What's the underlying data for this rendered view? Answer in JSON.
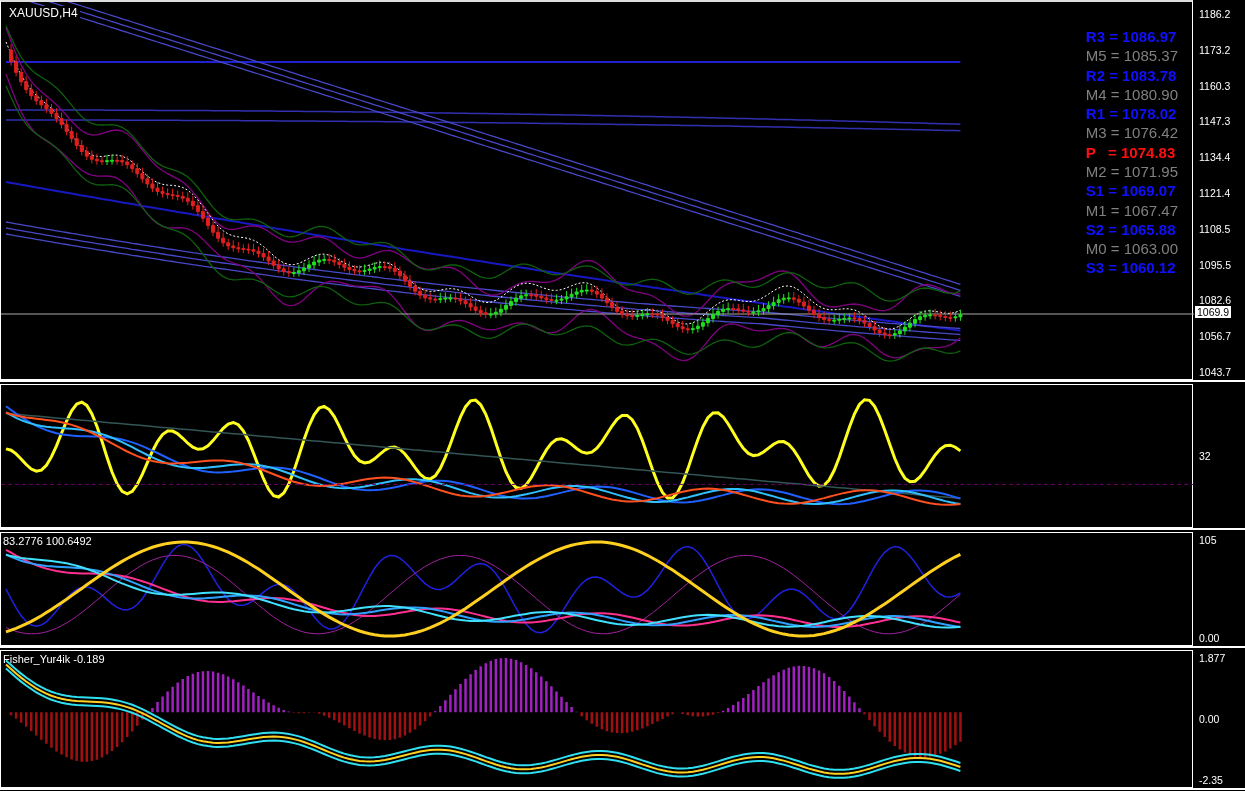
{
  "symbol_label": "XAUUSD,H4",
  "pivot_levels": [
    {
      "text": "R3 = 1086.97",
      "kind": "resistance"
    },
    {
      "text": "M5 = 1085.37",
      "kind": "mid"
    },
    {
      "text": "R2 = 1083.78",
      "kind": "resistance"
    },
    {
      "text": "M4 = 1080.90",
      "kind": "mid"
    },
    {
      "text": "R1 = 1078.02",
      "kind": "resistance"
    },
    {
      "text": "M3 = 1076.42",
      "kind": "mid"
    },
    {
      "text": "P   = 1074.83",
      "kind": "pivot"
    },
    {
      "text": "M2 = 1071.95",
      "kind": "mid"
    },
    {
      "text": "S1 = 1069.07",
      "kind": "support"
    },
    {
      "text": "M1 = 1067.47",
      "kind": "mid"
    },
    {
      "text": "S2 = 1065.88",
      "kind": "support"
    },
    {
      "text": "M0 = 1063.00",
      "kind": "mid"
    },
    {
      "text": "S3 = 1060.12",
      "kind": "support"
    }
  ],
  "price_axis": {
    "ticks": [
      "1186.2",
      "1173.2",
      "1160.3",
      "1147.3",
      "1134.4",
      "1121.4",
      "1108.5",
      "1095.5",
      "1082.6",
      "1056.7",
      "1043.7"
    ],
    "current_price": "1069.9"
  },
  "panes": [
    {
      "kind": "oscillator",
      "ticks": [
        "32"
      ]
    },
    {
      "kind": "stochastic",
      "label": "83.2776 100.6492",
      "ticks": [
        "105",
        "0.00"
      ]
    },
    {
      "kind": "histogram",
      "label": "Fisher_Yur4ik -0.189",
      "ticks": [
        "1.877",
        "0.00",
        "-2.35"
      ]
    }
  ]
}
